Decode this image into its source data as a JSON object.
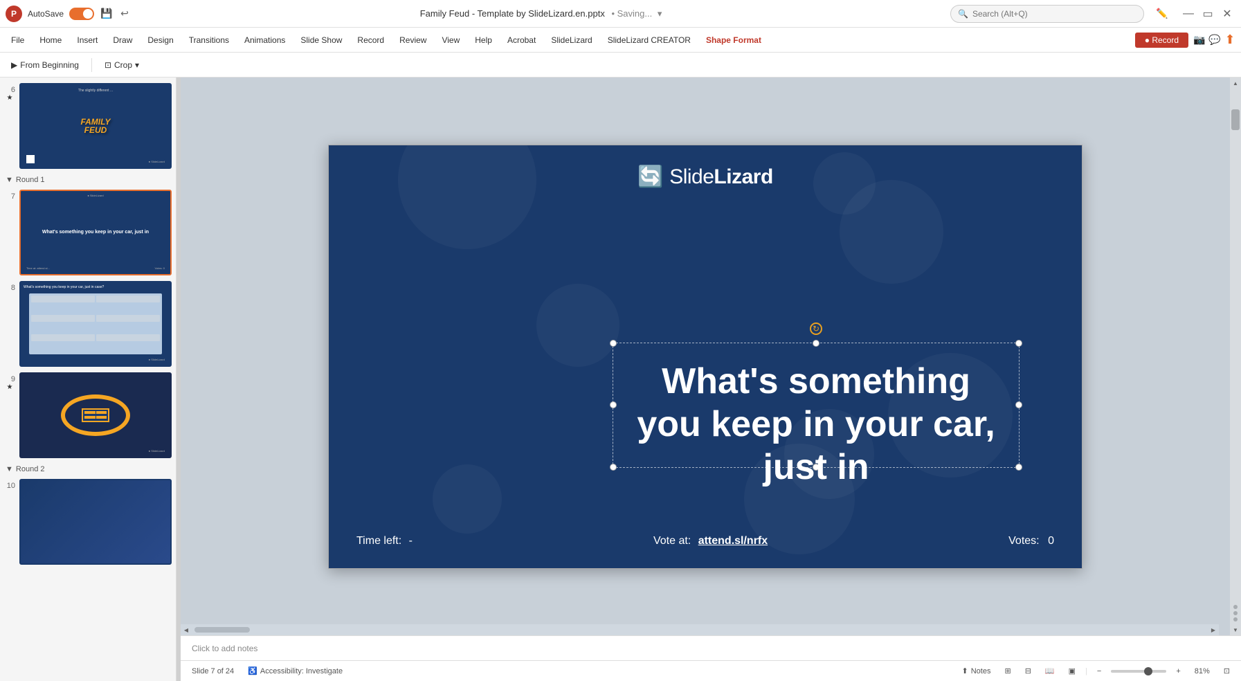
{
  "app": {
    "logo": "P",
    "autosave_label": "AutoSave",
    "file_name": "Family Feud - Template by SlideLizard.en.pptx",
    "saving_status": "• Saving...",
    "search_placeholder": "Search (Alt+Q)"
  },
  "ribbon": {
    "tabs": [
      {
        "label": "File",
        "active": false
      },
      {
        "label": "Home",
        "active": false
      },
      {
        "label": "Insert",
        "active": false
      },
      {
        "label": "Draw",
        "active": false
      },
      {
        "label": "Design",
        "active": false
      },
      {
        "label": "Transitions",
        "active": false
      },
      {
        "label": "Animations",
        "active": false
      },
      {
        "label": "Slide Show",
        "active": false
      },
      {
        "label": "Record",
        "active": false
      },
      {
        "label": "Review",
        "active": false
      },
      {
        "label": "View",
        "active": false
      },
      {
        "label": "Help",
        "active": false
      },
      {
        "label": "Acrobat",
        "active": false
      },
      {
        "label": "SlideLizard",
        "active": false
      },
      {
        "label": "SlideLizard CREATOR",
        "active": false
      },
      {
        "label": "Shape Format",
        "active": true
      }
    ],
    "record_button": "● Record"
  },
  "toolbar": {
    "from_beginning": "From Beginning",
    "crop": "Crop"
  },
  "slides": [
    {
      "number": "6",
      "star": "★",
      "type": "family-feud-title"
    },
    {
      "number": "7",
      "active": true,
      "type": "question-slide",
      "title": "What's something you keep in your car, just in"
    },
    {
      "number": "8",
      "type": "answer-slide"
    },
    {
      "number": "9",
      "star": "★",
      "type": "scoreboard"
    },
    {
      "number": "10",
      "type": "round2"
    }
  ],
  "sections": [
    {
      "label": "Round 1",
      "arrow": "▼",
      "indent": 1
    },
    {
      "label": "Round 2",
      "arrow": "▼",
      "indent": 2
    }
  ],
  "main_slide": {
    "logo_text_plain": "Slide",
    "logo_text_bold": "Lizard",
    "main_text": "What's something you keep in your car, just in",
    "time_left_label": "Time left:",
    "time_left_value": "-",
    "vote_label": "Vote at:",
    "vote_url": "attend.sl/nrfx",
    "votes_label": "Votes:",
    "votes_value": "0"
  },
  "status_bar": {
    "slide_info": "Slide 7 of 24",
    "accessibility": "Accessibility: Investigate",
    "notes_label": "Notes",
    "zoom_level": "81%",
    "notes_btn_label": "Notes"
  },
  "notes_placeholder": "Click to add notes",
  "colors": {
    "accent": "#e86e2d",
    "brand_red": "#c0392b",
    "slide_bg": "#1a3a6b",
    "shape_format_color": "#c0392b"
  }
}
